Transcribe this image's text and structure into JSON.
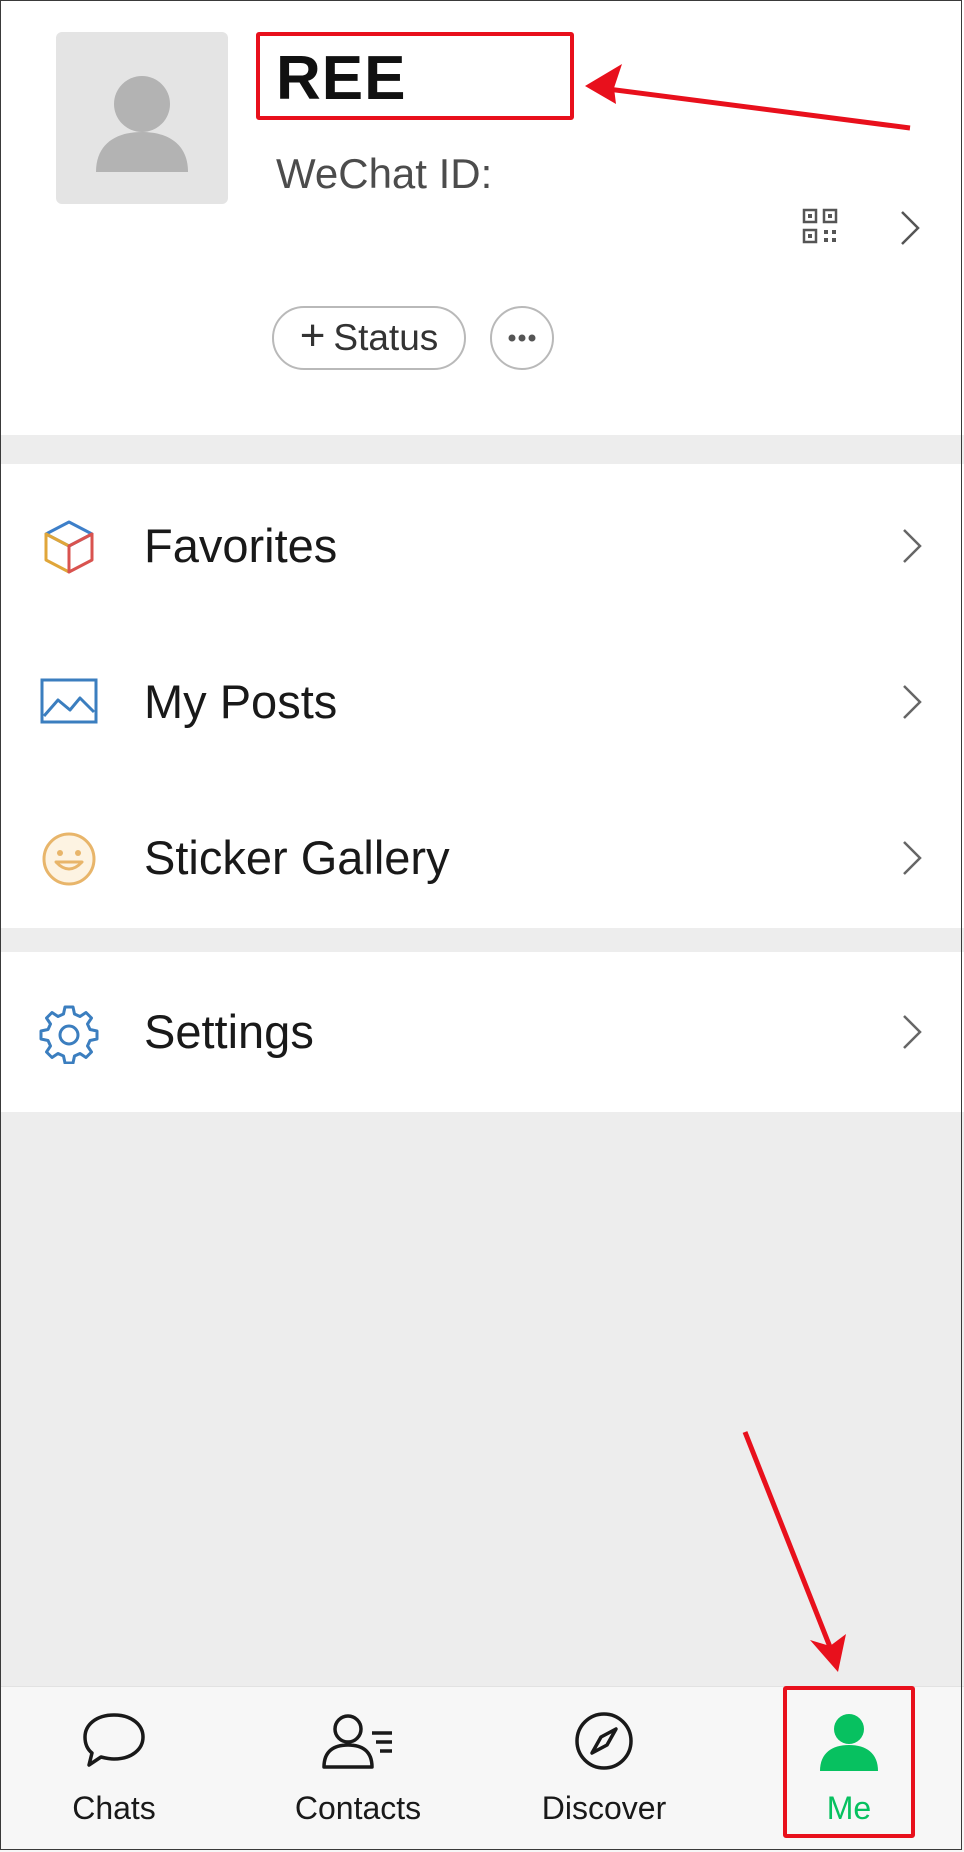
{
  "profile": {
    "name": "REE",
    "wechat_id_label": "WeChat ID:",
    "status_plus": "+",
    "status_label": "Status"
  },
  "menu": {
    "items": [
      {
        "label": "Favorites",
        "icon": "favorites-cube-icon"
      },
      {
        "label": "My Posts",
        "icon": "image-frame-icon"
      },
      {
        "label": "Sticker Gallery",
        "icon": "smiley-face-icon"
      },
      {
        "label": "Settings",
        "icon": "gear-icon"
      }
    ]
  },
  "tabbar": {
    "tabs": [
      {
        "label": "Chats",
        "icon": "chat-bubble-icon",
        "active": false
      },
      {
        "label": "Contacts",
        "icon": "contacts-icon",
        "active": false
      },
      {
        "label": "Discover",
        "icon": "compass-icon",
        "active": false
      },
      {
        "label": "Me",
        "icon": "person-icon",
        "active": true
      }
    ]
  },
  "colors": {
    "accent_green": "#07c160",
    "annotation_red": "#e8101c",
    "background": "#ededed"
  }
}
